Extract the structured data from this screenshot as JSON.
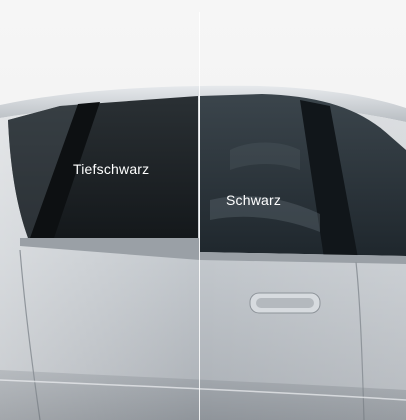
{
  "labels": {
    "left": "Tiefschwarz",
    "right": "Schwarz"
  },
  "colors": {
    "background": "#f4f4f4",
    "car_body": "#c9cdd1",
    "window_tiefschwarz": "#1d2226",
    "window_schwarz": "#2a3238"
  }
}
